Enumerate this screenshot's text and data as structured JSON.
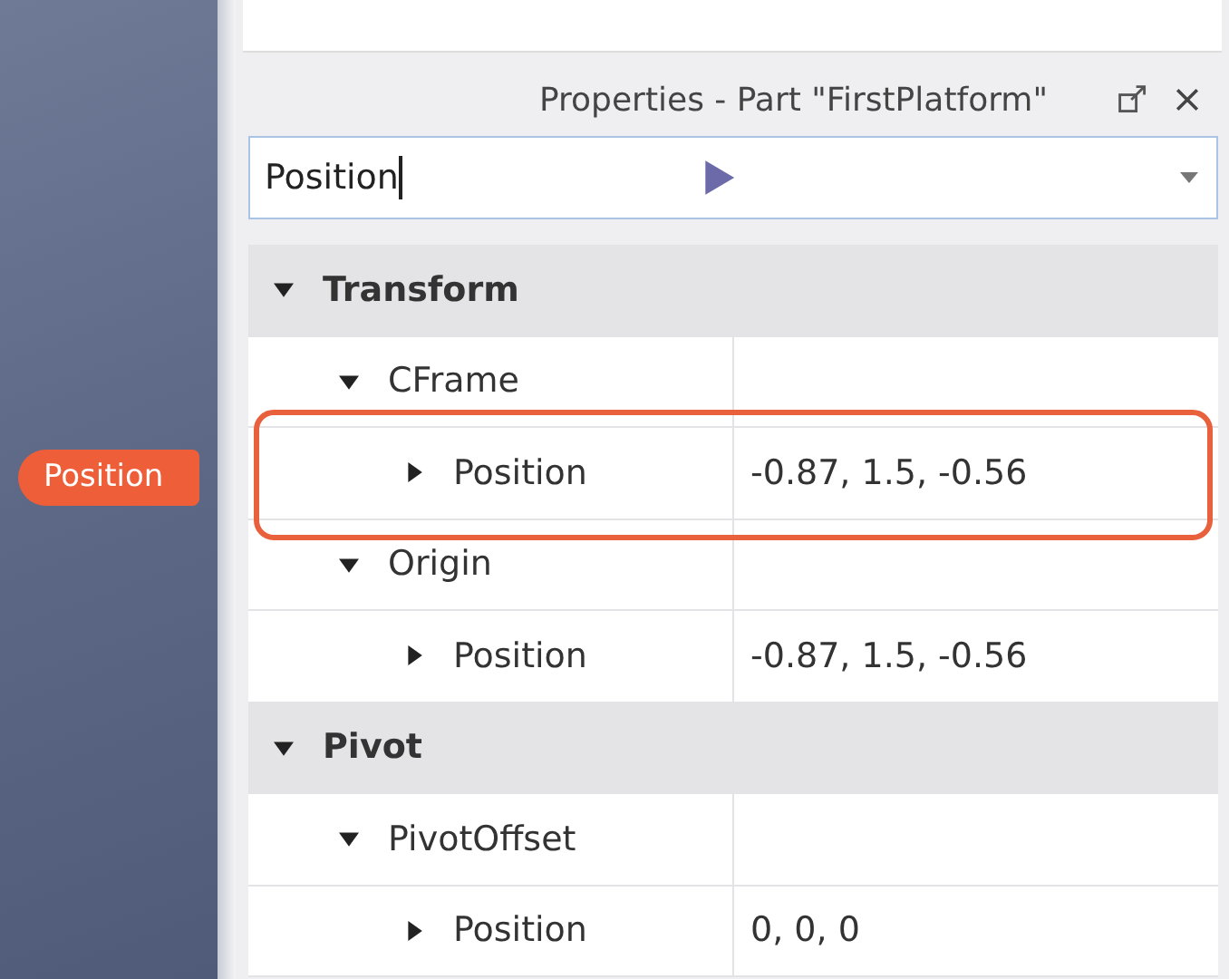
{
  "callout": {
    "label": "Position"
  },
  "panel": {
    "title": "Properties - Part \"FirstPlatform\""
  },
  "search": {
    "value": "Position"
  },
  "sections": [
    {
      "label": "Transform",
      "expanded": true,
      "children": [
        {
          "label": "CFrame",
          "expanded": true,
          "children": [
            {
              "label": "Position",
              "value": "-0.87, 1.5, -0.56",
              "expanded": false,
              "highlighted": true
            }
          ]
        },
        {
          "label": "Origin",
          "expanded": true,
          "children": [
            {
              "label": "Position",
              "value": "-0.87, 1.5, -0.56",
              "expanded": false,
              "highlighted": false
            }
          ]
        }
      ]
    },
    {
      "label": "Pivot",
      "expanded": true,
      "children": [
        {
          "label": "PivotOffset",
          "expanded": true,
          "children": [
            {
              "label": "Position",
              "value": "0, 0, 0",
              "expanded": false,
              "highlighted": false
            }
          ]
        }
      ]
    }
  ]
}
